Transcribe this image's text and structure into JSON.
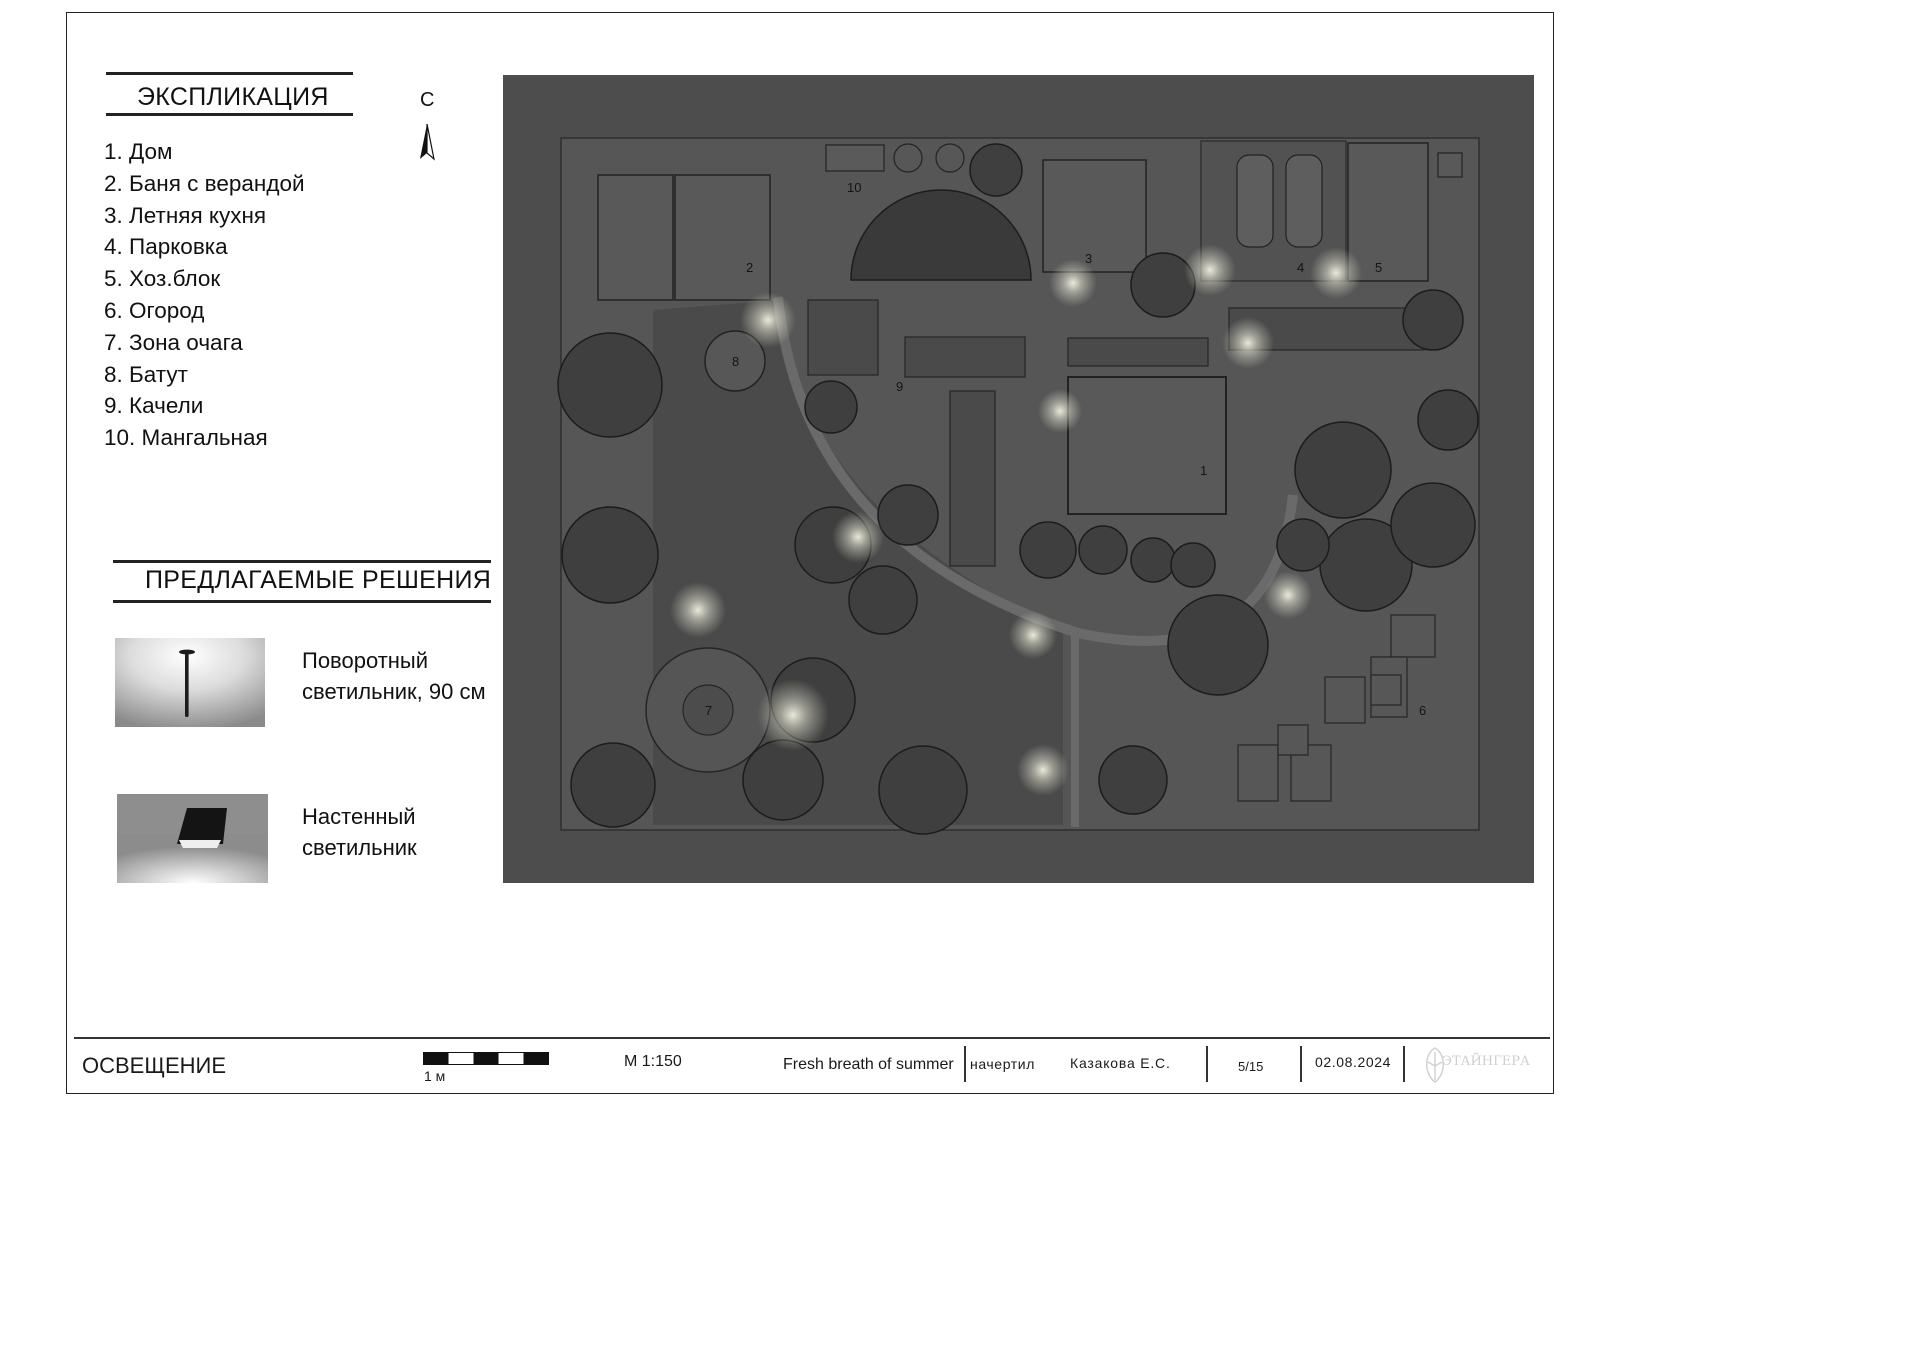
{
  "explication": {
    "title": "ЭКСПЛИКАЦИЯ",
    "items": [
      "1. Дом",
      "2. Баня с верандой",
      "3. Летняя кухня",
      "4. Парковка",
      "5. Хоз.блок",
      "6. Огород",
      "7. Зона очага",
      "8. Батут",
      "9. Качели",
      "10. Мангальная"
    ]
  },
  "north": {
    "letter": "С"
  },
  "solutions": {
    "title": "ПРЕДЛАГАЕМЫЕ РЕШЕНИЯ",
    "items": [
      {
        "lines": [
          "Поворотный",
          "светильник, 90 см"
        ],
        "icon": "bollard-lamp-icon"
      },
      {
        "lines": [
          "Настенный",
          "светильник"
        ],
        "icon": "wall-lamp-icon"
      }
    ]
  },
  "plan": {
    "labels": [
      "1",
      "2",
      "3",
      "4",
      "5",
      "6",
      "7",
      "8",
      "9",
      "10"
    ]
  },
  "title_block": {
    "sheet_title": "ОСВЕЩЕНИЕ",
    "scale_bar_label": "1 м",
    "scale": "М 1:150",
    "project": "Fresh breath of summer",
    "role": "начертил",
    "author": "Казакова Е.С.",
    "sheet_number": "5/15",
    "date": "02.08.2024",
    "logo_text": "ЭТАЙНГЕРА"
  },
  "colors": {
    "plan_background": "#4d4d4d",
    "light_glow": "#f2f2e0",
    "frame": "#222222"
  }
}
